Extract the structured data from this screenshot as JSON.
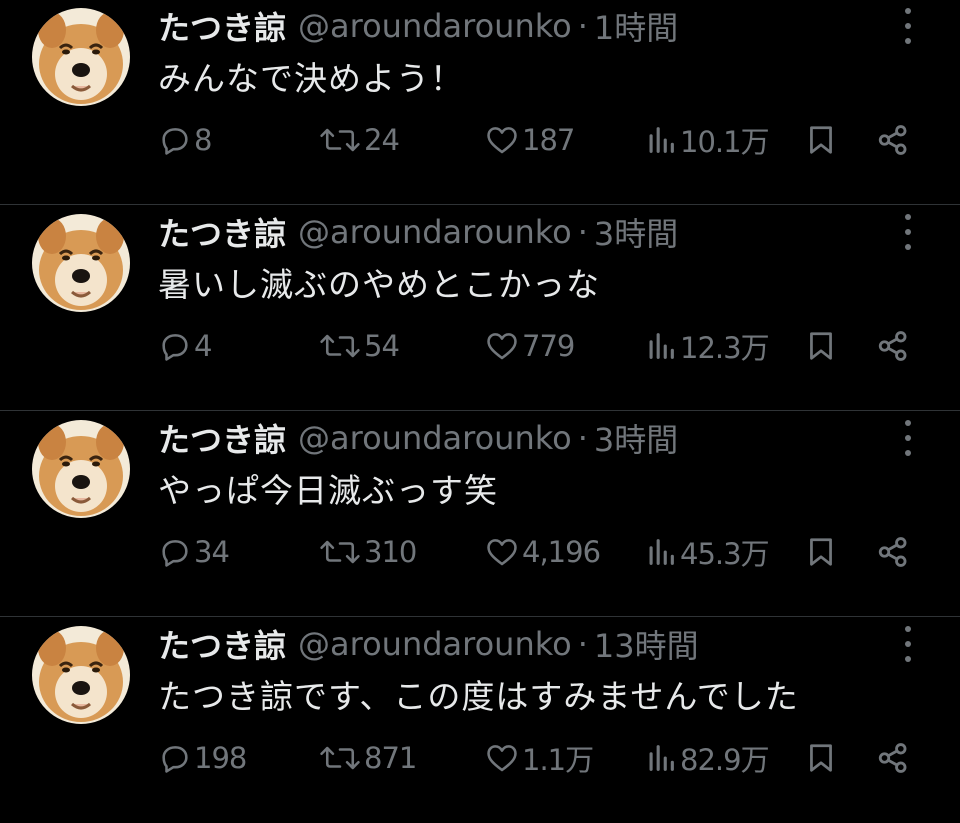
{
  "colors": {
    "background": "#000000",
    "primary_text": "#e7e9ea",
    "secondary_text": "#71767b",
    "divider": "#2f3336"
  },
  "tweets": [
    {
      "name": "たつき諒",
      "handle": "@aroundarounko",
      "separator": "·",
      "time": "1時間",
      "text": "みんなで決めよう！",
      "replies": "8",
      "retweets": "24",
      "likes": "187",
      "views": "10.1万"
    },
    {
      "name": "たつき諒",
      "handle": "@aroundarounko",
      "separator": "·",
      "time": "3時間",
      "text": "暑いし滅ぶのやめとこかっな",
      "replies": "4",
      "retweets": "54",
      "likes": "779",
      "views": "12.3万"
    },
    {
      "name": "たつき諒",
      "handle": "@aroundarounko",
      "separator": "·",
      "time": "3時間",
      "text": "やっぱ今日滅ぶっす笑",
      "replies": "34",
      "retweets": "310",
      "likes": "4,196",
      "views": "45.3万"
    },
    {
      "name": "たつき諒",
      "handle": "@aroundarounko",
      "separator": "·",
      "time": "13時間",
      "text": "たつき諒です、この度はすみませんでした",
      "replies": "198",
      "retweets": "871",
      "likes": "1.1万",
      "views": "82.9万"
    }
  ],
  "icons": {
    "reply": "speech-bubble-icon",
    "retweet": "retweet-arrows-icon",
    "like": "heart-icon",
    "views": "bar-chart-icon",
    "bookmark": "bookmark-icon",
    "share": "share-nodes-icon",
    "more": "vertical-dots-icon",
    "avatar": "shiba-dog-face"
  }
}
